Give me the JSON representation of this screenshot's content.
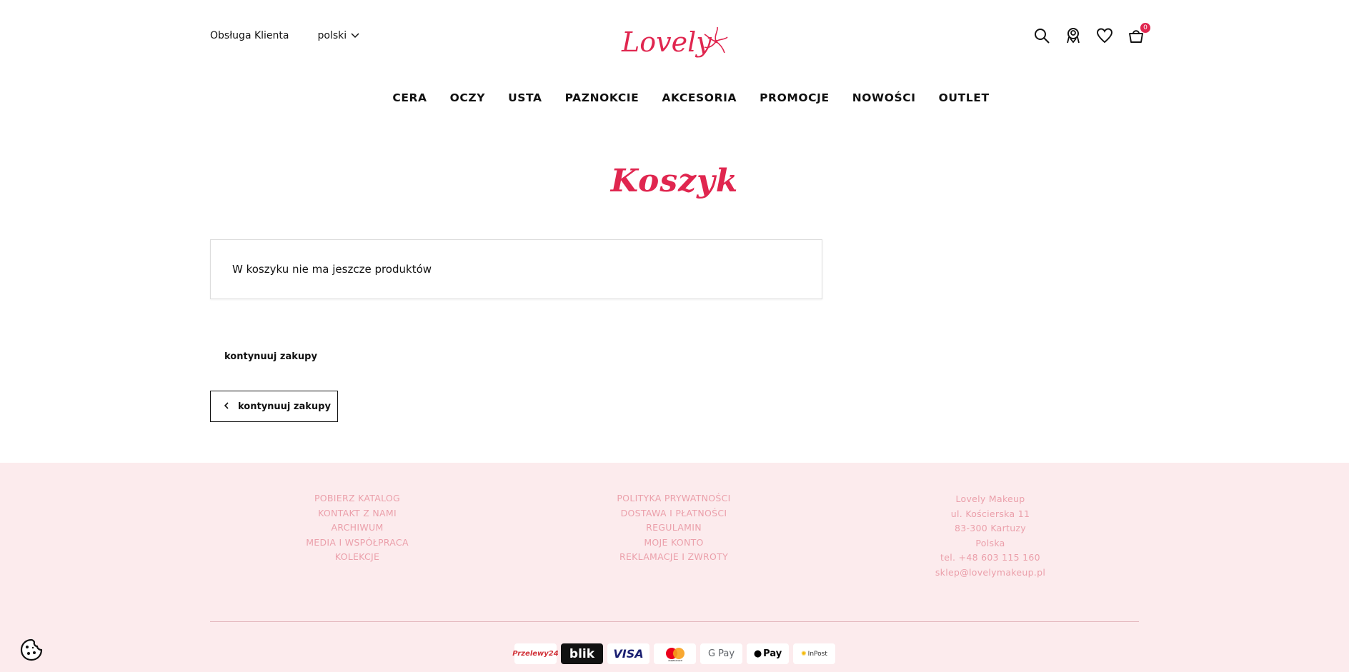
{
  "header": {
    "customer_service": "Obsługa Klienta",
    "language": "polski",
    "logo_text": "Lovely",
    "cart_count": "0"
  },
  "nav": {
    "items": [
      "CERA",
      "OCZY",
      "USTA",
      "PAZNOKCIE",
      "AKCESORIA",
      "PROMOCJE",
      "NOWOŚCI",
      "OUTLET"
    ]
  },
  "main": {
    "title": "Koszyk",
    "empty_message": "W koszyku nie ma jeszcze produktów",
    "continue_link": "kontynuuj zakupy",
    "continue_button": "kontynuuj zakupy"
  },
  "footer": {
    "col1": [
      "POBIERZ KATALOG",
      "KONTAKT Z NAMI",
      "ARCHIWUM",
      "MEDIA I WSPÓŁPRACA",
      "KOLEKCJE"
    ],
    "col2": [
      "POLITYKA PRYWATNOŚCI",
      "DOSTAWA I PŁATNOŚCI",
      "REGULAMIN",
      "MOJE KONTO",
      "REKLAMACJE I ZWROTY"
    ],
    "col3": [
      "Lovely Makeup",
      "ul. Kościerska 11",
      "83-300 Kartuzy",
      "Polska",
      "tel. +48 603 115 160",
      "sklep@lovelymakeup.pl"
    ],
    "payments": [
      "Przelewy24",
      "blik",
      "VISA",
      "mastercard",
      "G Pay",
      "Pay",
      "InPost"
    ]
  },
  "colors": {
    "accent": "#e0264f",
    "footer_bg": "#fcebed",
    "footer_text": "#eba0ab"
  },
  "icons": [
    "search-icon",
    "account-icon",
    "heart-icon",
    "cart-icon",
    "chevron-down-icon",
    "chevron-left-icon",
    "cookie-icon"
  ]
}
